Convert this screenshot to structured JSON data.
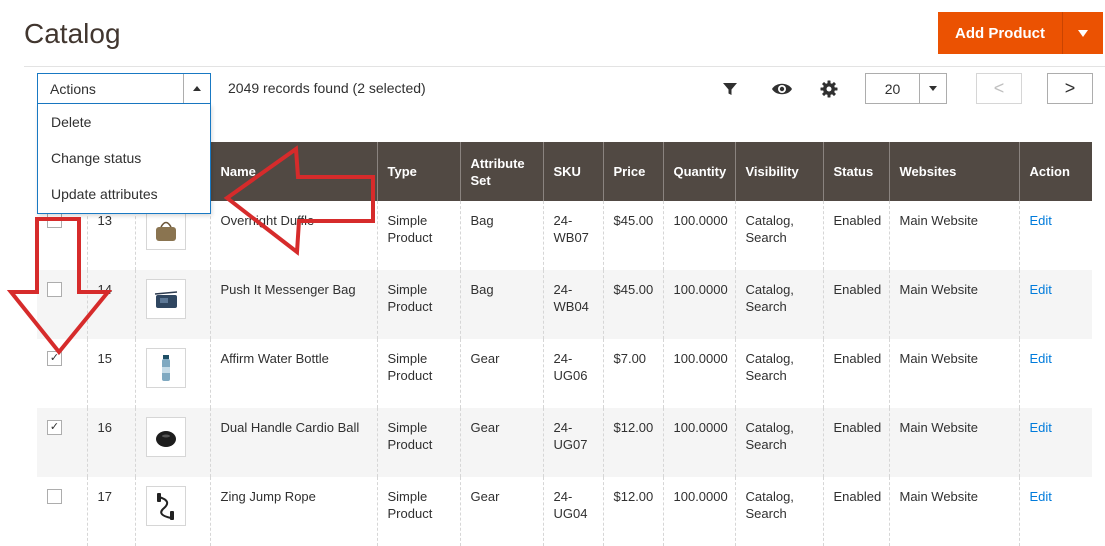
{
  "header": {
    "title": "Catalog",
    "add_button": "Add Product"
  },
  "toolbar": {
    "actions_label": "Actions",
    "records": "2049 records found (2 selected)",
    "per_page": "20",
    "prev": "<",
    "next": ">",
    "filter_icon": "filter-icon",
    "view_icon": "eye-icon",
    "settings_icon": "gear-icon"
  },
  "actions_menu": [
    "Delete",
    "Change status",
    "Update attributes"
  ],
  "columns": [
    "",
    "",
    "",
    "Name",
    "Type",
    "Attribute Set",
    "SKU",
    "Price",
    "Quantity",
    "Visibility",
    "Status",
    "Websites",
    "Action"
  ],
  "rows": [
    {
      "checked": false,
      "id": "13",
      "thumb": "duffle-bag",
      "name": "Overnight Duffle",
      "type": "Simple Product",
      "attr": "Bag",
      "sku": "24-WB07",
      "price": "$45.00",
      "qty": "100.0000",
      "visibility": "Catalog, Search",
      "status": "Enabled",
      "websites": "Main Website",
      "action": "Edit"
    },
    {
      "checked": false,
      "id": "14",
      "thumb": "messenger-bag",
      "name": "Push It Messenger Bag",
      "type": "Simple Product",
      "attr": "Bag",
      "sku": "24-WB04",
      "price": "$45.00",
      "qty": "100.0000",
      "visibility": "Catalog, Search",
      "status": "Enabled",
      "websites": "Main Website",
      "action": "Edit"
    },
    {
      "checked": true,
      "id": "15",
      "thumb": "water-bottle",
      "name": "Affirm Water Bottle",
      "type": "Simple Product",
      "attr": "Gear",
      "sku": "24-UG06",
      "price": "$7.00",
      "qty": "100.0000",
      "visibility": "Catalog, Search",
      "status": "Enabled",
      "websites": "Main Website",
      "action": "Edit"
    },
    {
      "checked": true,
      "id": "16",
      "thumb": "cardio-ball",
      "name": "Dual Handle Cardio Ball",
      "type": "Simple Product",
      "attr": "Gear",
      "sku": "24-UG07",
      "price": "$12.00",
      "qty": "100.0000",
      "visibility": "Catalog, Search",
      "status": "Enabled",
      "websites": "Main Website",
      "action": "Edit"
    },
    {
      "checked": false,
      "id": "17",
      "thumb": "jump-rope",
      "name": "Zing Jump Rope",
      "type": "Simple Product",
      "attr": "Gear",
      "sku": "24-UG04",
      "price": "$12.00",
      "qty": "100.0000",
      "visibility": "Catalog, Search",
      "status": "Enabled",
      "websites": "Main Website",
      "action": "Edit"
    }
  ],
  "colors": {
    "accent": "#eb5202",
    "header_bg": "#514943",
    "link": "#007bdb",
    "annotation_arrow": "#d62b2b"
  }
}
